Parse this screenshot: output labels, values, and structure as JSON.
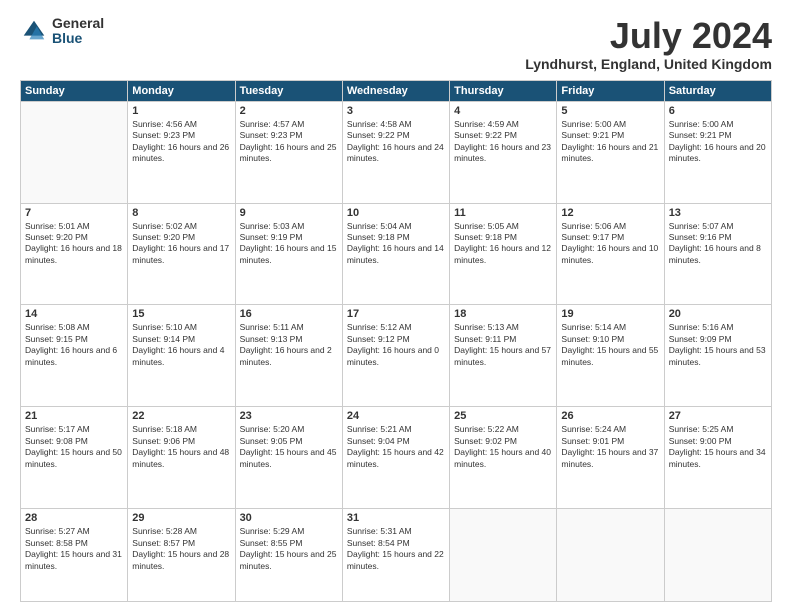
{
  "logo": {
    "general": "General",
    "blue": "Blue"
  },
  "header": {
    "title": "July 2024",
    "subtitle": "Lyndhurst, England, United Kingdom"
  },
  "weekdays": [
    "Sunday",
    "Monday",
    "Tuesday",
    "Wednesday",
    "Thursday",
    "Friday",
    "Saturday"
  ],
  "weeks": [
    [
      {
        "day": "",
        "sunrise": "",
        "sunset": "",
        "daylight": ""
      },
      {
        "day": "1",
        "sunrise": "Sunrise: 4:56 AM",
        "sunset": "Sunset: 9:23 PM",
        "daylight": "Daylight: 16 hours and 26 minutes."
      },
      {
        "day": "2",
        "sunrise": "Sunrise: 4:57 AM",
        "sunset": "Sunset: 9:23 PM",
        "daylight": "Daylight: 16 hours and 25 minutes."
      },
      {
        "day": "3",
        "sunrise": "Sunrise: 4:58 AM",
        "sunset": "Sunset: 9:22 PM",
        "daylight": "Daylight: 16 hours and 24 minutes."
      },
      {
        "day": "4",
        "sunrise": "Sunrise: 4:59 AM",
        "sunset": "Sunset: 9:22 PM",
        "daylight": "Daylight: 16 hours and 23 minutes."
      },
      {
        "day": "5",
        "sunrise": "Sunrise: 5:00 AM",
        "sunset": "Sunset: 9:21 PM",
        "daylight": "Daylight: 16 hours and 21 minutes."
      },
      {
        "day": "6",
        "sunrise": "Sunrise: 5:00 AM",
        "sunset": "Sunset: 9:21 PM",
        "daylight": "Daylight: 16 hours and 20 minutes."
      }
    ],
    [
      {
        "day": "7",
        "sunrise": "Sunrise: 5:01 AM",
        "sunset": "Sunset: 9:20 PM",
        "daylight": "Daylight: 16 hours and 18 minutes."
      },
      {
        "day": "8",
        "sunrise": "Sunrise: 5:02 AM",
        "sunset": "Sunset: 9:20 PM",
        "daylight": "Daylight: 16 hours and 17 minutes."
      },
      {
        "day": "9",
        "sunrise": "Sunrise: 5:03 AM",
        "sunset": "Sunset: 9:19 PM",
        "daylight": "Daylight: 16 hours and 15 minutes."
      },
      {
        "day": "10",
        "sunrise": "Sunrise: 5:04 AM",
        "sunset": "Sunset: 9:18 PM",
        "daylight": "Daylight: 16 hours and 14 minutes."
      },
      {
        "day": "11",
        "sunrise": "Sunrise: 5:05 AM",
        "sunset": "Sunset: 9:18 PM",
        "daylight": "Daylight: 16 hours and 12 minutes."
      },
      {
        "day": "12",
        "sunrise": "Sunrise: 5:06 AM",
        "sunset": "Sunset: 9:17 PM",
        "daylight": "Daylight: 16 hours and 10 minutes."
      },
      {
        "day": "13",
        "sunrise": "Sunrise: 5:07 AM",
        "sunset": "Sunset: 9:16 PM",
        "daylight": "Daylight: 16 hours and 8 minutes."
      }
    ],
    [
      {
        "day": "14",
        "sunrise": "Sunrise: 5:08 AM",
        "sunset": "Sunset: 9:15 PM",
        "daylight": "Daylight: 16 hours and 6 minutes."
      },
      {
        "day": "15",
        "sunrise": "Sunrise: 5:10 AM",
        "sunset": "Sunset: 9:14 PM",
        "daylight": "Daylight: 16 hours and 4 minutes."
      },
      {
        "day": "16",
        "sunrise": "Sunrise: 5:11 AM",
        "sunset": "Sunset: 9:13 PM",
        "daylight": "Daylight: 16 hours and 2 minutes."
      },
      {
        "day": "17",
        "sunrise": "Sunrise: 5:12 AM",
        "sunset": "Sunset: 9:12 PM",
        "daylight": "Daylight: 16 hours and 0 minutes."
      },
      {
        "day": "18",
        "sunrise": "Sunrise: 5:13 AM",
        "sunset": "Sunset: 9:11 PM",
        "daylight": "Daylight: 15 hours and 57 minutes."
      },
      {
        "day": "19",
        "sunrise": "Sunrise: 5:14 AM",
        "sunset": "Sunset: 9:10 PM",
        "daylight": "Daylight: 15 hours and 55 minutes."
      },
      {
        "day": "20",
        "sunrise": "Sunrise: 5:16 AM",
        "sunset": "Sunset: 9:09 PM",
        "daylight": "Daylight: 15 hours and 53 minutes."
      }
    ],
    [
      {
        "day": "21",
        "sunrise": "Sunrise: 5:17 AM",
        "sunset": "Sunset: 9:08 PM",
        "daylight": "Daylight: 15 hours and 50 minutes."
      },
      {
        "day": "22",
        "sunrise": "Sunrise: 5:18 AM",
        "sunset": "Sunset: 9:06 PM",
        "daylight": "Daylight: 15 hours and 48 minutes."
      },
      {
        "day": "23",
        "sunrise": "Sunrise: 5:20 AM",
        "sunset": "Sunset: 9:05 PM",
        "daylight": "Daylight: 15 hours and 45 minutes."
      },
      {
        "day": "24",
        "sunrise": "Sunrise: 5:21 AM",
        "sunset": "Sunset: 9:04 PM",
        "daylight": "Daylight: 15 hours and 42 minutes."
      },
      {
        "day": "25",
        "sunrise": "Sunrise: 5:22 AM",
        "sunset": "Sunset: 9:02 PM",
        "daylight": "Daylight: 15 hours and 40 minutes."
      },
      {
        "day": "26",
        "sunrise": "Sunrise: 5:24 AM",
        "sunset": "Sunset: 9:01 PM",
        "daylight": "Daylight: 15 hours and 37 minutes."
      },
      {
        "day": "27",
        "sunrise": "Sunrise: 5:25 AM",
        "sunset": "Sunset: 9:00 PM",
        "daylight": "Daylight: 15 hours and 34 minutes."
      }
    ],
    [
      {
        "day": "28",
        "sunrise": "Sunrise: 5:27 AM",
        "sunset": "Sunset: 8:58 PM",
        "daylight": "Daylight: 15 hours and 31 minutes."
      },
      {
        "day": "29",
        "sunrise": "Sunrise: 5:28 AM",
        "sunset": "Sunset: 8:57 PM",
        "daylight": "Daylight: 15 hours and 28 minutes."
      },
      {
        "day": "30",
        "sunrise": "Sunrise: 5:29 AM",
        "sunset": "Sunset: 8:55 PM",
        "daylight": "Daylight: 15 hours and 25 minutes."
      },
      {
        "day": "31",
        "sunrise": "Sunrise: 5:31 AM",
        "sunset": "Sunset: 8:54 PM",
        "daylight": "Daylight: 15 hours and 22 minutes."
      },
      {
        "day": "",
        "sunrise": "",
        "sunset": "",
        "daylight": ""
      },
      {
        "day": "",
        "sunrise": "",
        "sunset": "",
        "daylight": ""
      },
      {
        "day": "",
        "sunrise": "",
        "sunset": "",
        "daylight": ""
      }
    ]
  ]
}
